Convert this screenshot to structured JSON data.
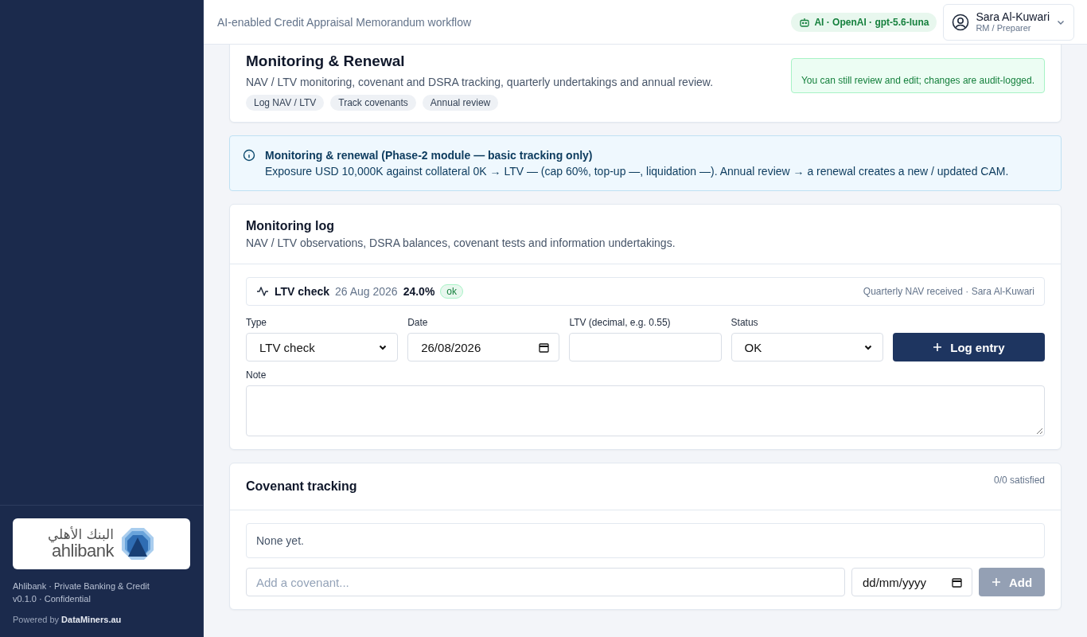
{
  "header": {
    "subtitle": "AI-enabled Credit Appraisal Memorandum workflow",
    "ai_badge": "AI · OpenAI · gpt-5.6-luna",
    "user": {
      "name": "Sara Al-Kuwari",
      "role": "RM / Preparer"
    }
  },
  "sidebar": {
    "logo_arabic": "البنك الأهلي",
    "logo_latin": "ahlibank",
    "org_line": "Ahlibank · Private Banking & Credit",
    "version_line": "v0.1.0 · Confidential",
    "powered_prefix": "Powered by",
    "powered_brand": "DataMiners.au"
  },
  "stage": {
    "title": "Monitoring & Renewal",
    "description": "NAV / LTV monitoring, covenant and DSRA tracking, quarterly undertakings and annual review.",
    "chips": [
      "Log NAV / LTV",
      "Track covenants",
      "Annual review"
    ],
    "notice": "You can still review and edit; changes are audit-logged."
  },
  "info": {
    "title": "Monitoring & renewal (Phase-2 module — basic tracking only)",
    "body": "Exposure USD 10,000K against collateral 0K → LTV — (cap 60%, top-up —, liquidation —). Annual review → a renewal creates a new / updated CAM."
  },
  "monitoring_log": {
    "title": "Monitoring log",
    "subtitle": "NAV / LTV observations, DSRA balances, covenant tests and information undertakings.",
    "entries": [
      {
        "type": "LTV check",
        "date": "26 Aug 2026",
        "value": "24.0%",
        "status": "ok",
        "note": "Quarterly NAV received · Sara Al-Kuwari"
      }
    ],
    "fields": [
      {
        "kind": "select",
        "label": "Type",
        "value": "LTV check"
      },
      {
        "kind": "date",
        "label": "Date",
        "value": "26/08/2026"
      },
      {
        "kind": "text",
        "label": "LTV (decimal, e.g. 0.55)"
      },
      {
        "kind": "select",
        "label": "Status",
        "value": "OK"
      }
    ],
    "button": "Log entry",
    "note_label": "Note"
  },
  "covenants": {
    "title": "Covenant tracking",
    "summary": "0/0 satisfied",
    "empty_text": "None yet.",
    "add_placeholder": "Add a covenant...",
    "date_placeholder": "dd/mm/yyyy",
    "add_button": {
      "label": "Add",
      "disabled": true
    }
  }
}
